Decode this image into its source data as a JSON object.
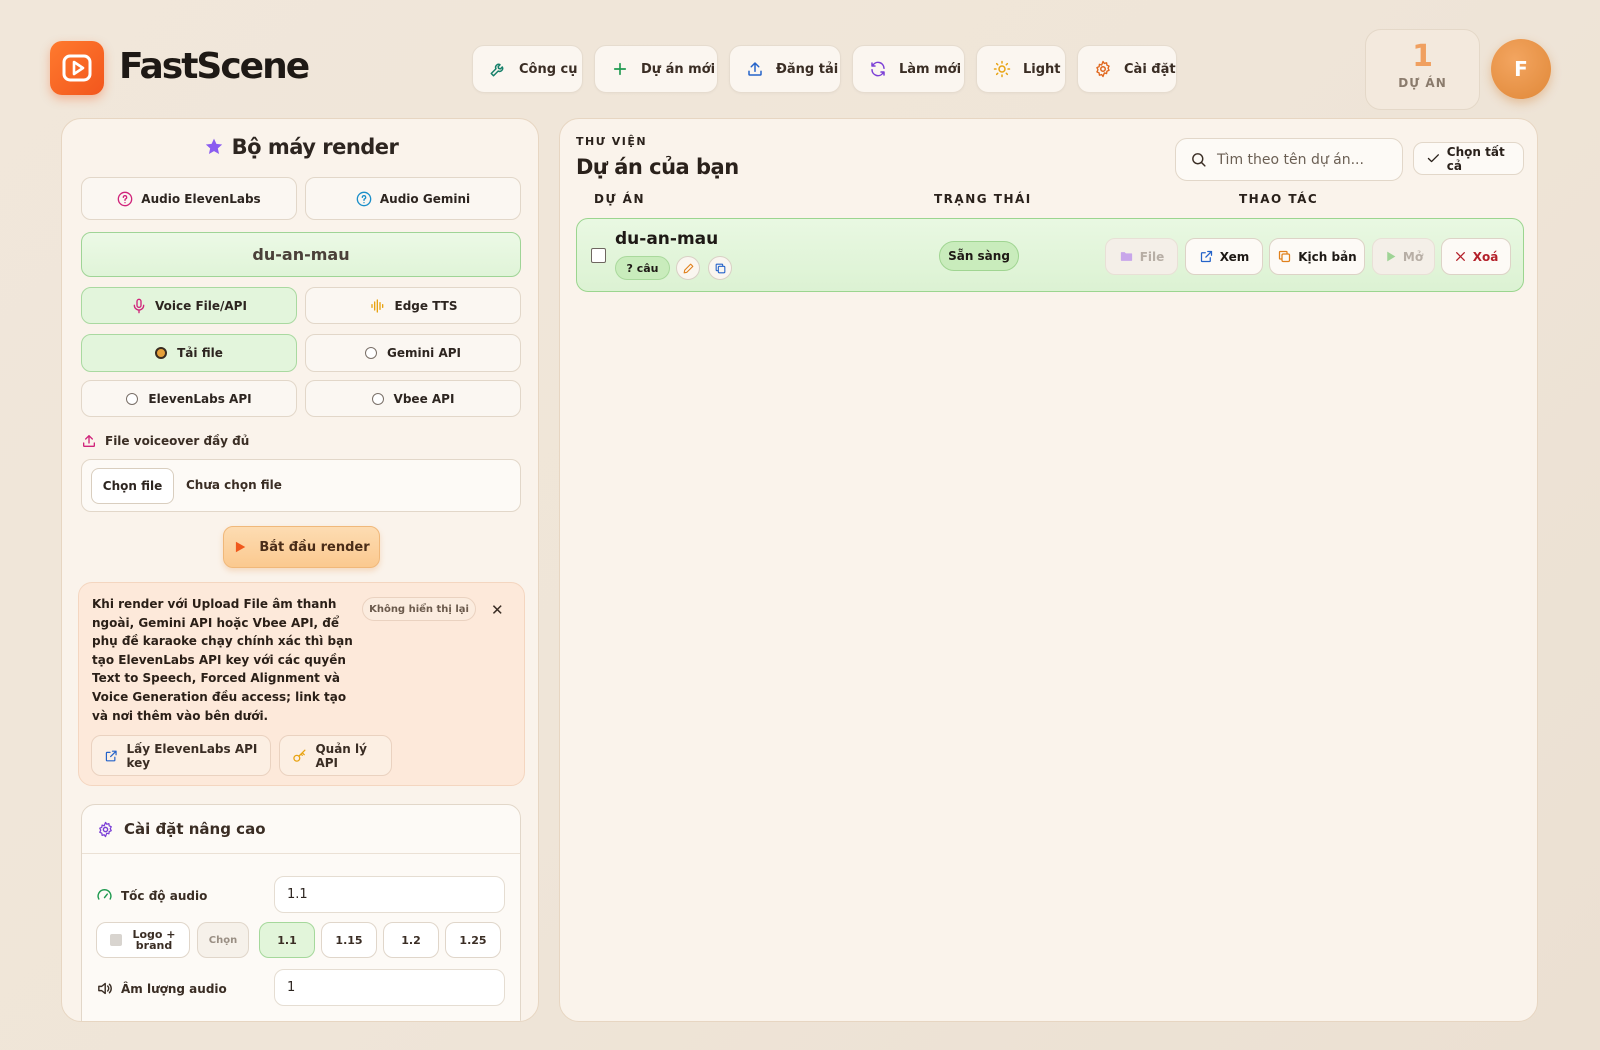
{
  "app": {
    "name": "FastScene"
  },
  "toolbar": {
    "tools": "Công cụ",
    "new_project": "Dự án mới",
    "upload": "Đăng tải",
    "refresh": "Làm mới",
    "theme": "Light",
    "settings": "Cài đặt"
  },
  "stats": {
    "count": "1",
    "label": "DỰ ÁN"
  },
  "user": {
    "initial": "F"
  },
  "render_panel": {
    "title": "Bộ máy render",
    "audio_elevenlabs": "Audio ElevenLabs",
    "audio_gemini": "Audio Gemini",
    "project_name": "du-an-mau",
    "voice_file_api": "Voice File/API",
    "edge_tts": "Edge TTS",
    "sources": [
      {
        "label": "Tải file",
        "selected": true
      },
      {
        "label": "Gemini API",
        "selected": false
      },
      {
        "label": "ElevenLabs API",
        "selected": false
      },
      {
        "label": "Vbee API",
        "selected": false
      }
    ],
    "voiceover_label": "File voiceover đầy đủ",
    "choose_file": "Chọn file",
    "no_file": "Chưa chọn file",
    "start_render": "Bắt đầu render",
    "notice": {
      "text": "Khi render với Upload File âm thanh ngoài, Gemini API hoặc Vbee API, để phụ đề karaoke chạy chính xác thì bạn tạo ElevenLabs API key với các quyền Text to Speech, Forced Alignment và Voice Generation đều access; link tạo và nơi thêm vào bên dưới.",
      "dismiss": "Không hiển thị lại",
      "get_key": "Lấy ElevenLabs API key",
      "manage_api": "Quản lý API"
    },
    "advanced": {
      "title": "Cài đặt nâng cao",
      "speed_label": "Tốc độ audio",
      "speed_value": "1.1",
      "logo_brand": "Logo + brand",
      "choose": "Chọn",
      "speed_options": [
        "1.1",
        "1.15",
        "1.2",
        "1.25"
      ],
      "selected_speed": "1.1",
      "volume_label": "Âm lượng audio",
      "volume_value": "1"
    }
  },
  "library": {
    "kicker": "THƯ VIỆN",
    "title": "Dự án của bạn",
    "search_placeholder": "Tìm theo tên dự án...",
    "select_all": "Chọn tất cả",
    "columns": {
      "project": "DỰ ÁN",
      "status": "TRẠNG THÁI",
      "actions": "THAO TÁC"
    },
    "rows": [
      {
        "name": "du-an-mau",
        "sentences": "? câu",
        "status": "Sẵn sàng",
        "actions": {
          "file": "File",
          "view": "Xem",
          "script": "Kịch bản",
          "open": "Mở",
          "delete": "Xoá"
        }
      }
    ]
  },
  "colors": {
    "accent": "#f2561d",
    "success_bg": "#e3f5dc",
    "success_border": "#a9d9a0",
    "danger": "#b4202a"
  }
}
